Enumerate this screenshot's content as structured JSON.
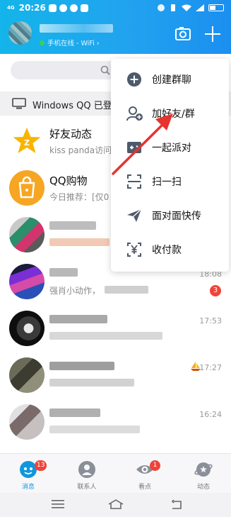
{
  "statusbar": {
    "network": "4G",
    "time": "20:26"
  },
  "header": {
    "online_status": "手机在线 - WiFi ›"
  },
  "windows_bar": {
    "text": "Windows QQ 已登录"
  },
  "menu": {
    "items": [
      {
        "label": "创建群聊",
        "icon": "add-circle-icon"
      },
      {
        "label": "加好友/群",
        "icon": "add-friend-icon"
      },
      {
        "label": "一起派对",
        "icon": "party-icon"
      },
      {
        "label": "扫一扫",
        "icon": "scan-icon"
      },
      {
        "label": "面对面快传",
        "icon": "send-plane-icon"
      },
      {
        "label": "收付款",
        "icon": "payment-icon"
      }
    ]
  },
  "chats": [
    {
      "name": "好友动态",
      "preview": "kiss panda访问",
      "time": "",
      "badge": ""
    },
    {
      "name": "QQ购物",
      "preview": "今日推荐：[仅0",
      "time": "",
      "badge": ""
    },
    {
      "name": "",
      "preview": "",
      "time": "",
      "badge": ""
    },
    {
      "name": "",
      "preview": "强肖小动作，",
      "time": "18:08",
      "badge": "3"
    },
    {
      "name": "",
      "preview": "",
      "time": "17:53",
      "badge": ""
    },
    {
      "name": "",
      "preview": "",
      "time": "17:27",
      "badge": ""
    },
    {
      "name": "",
      "preview": "",
      "time": "16:24",
      "badge": ""
    }
  ],
  "tabs": [
    {
      "label": "消息",
      "badge": "13",
      "active": true
    },
    {
      "label": "联系人",
      "badge": "",
      "active": false
    },
    {
      "label": "看点",
      "badge": "1",
      "active": false
    },
    {
      "label": "动态",
      "badge": "",
      "active": false
    }
  ],
  "colors": {
    "header": "#1aa6ee",
    "accent": "#1296db",
    "badge": "#f0433a",
    "arrow": "#e8322d"
  }
}
